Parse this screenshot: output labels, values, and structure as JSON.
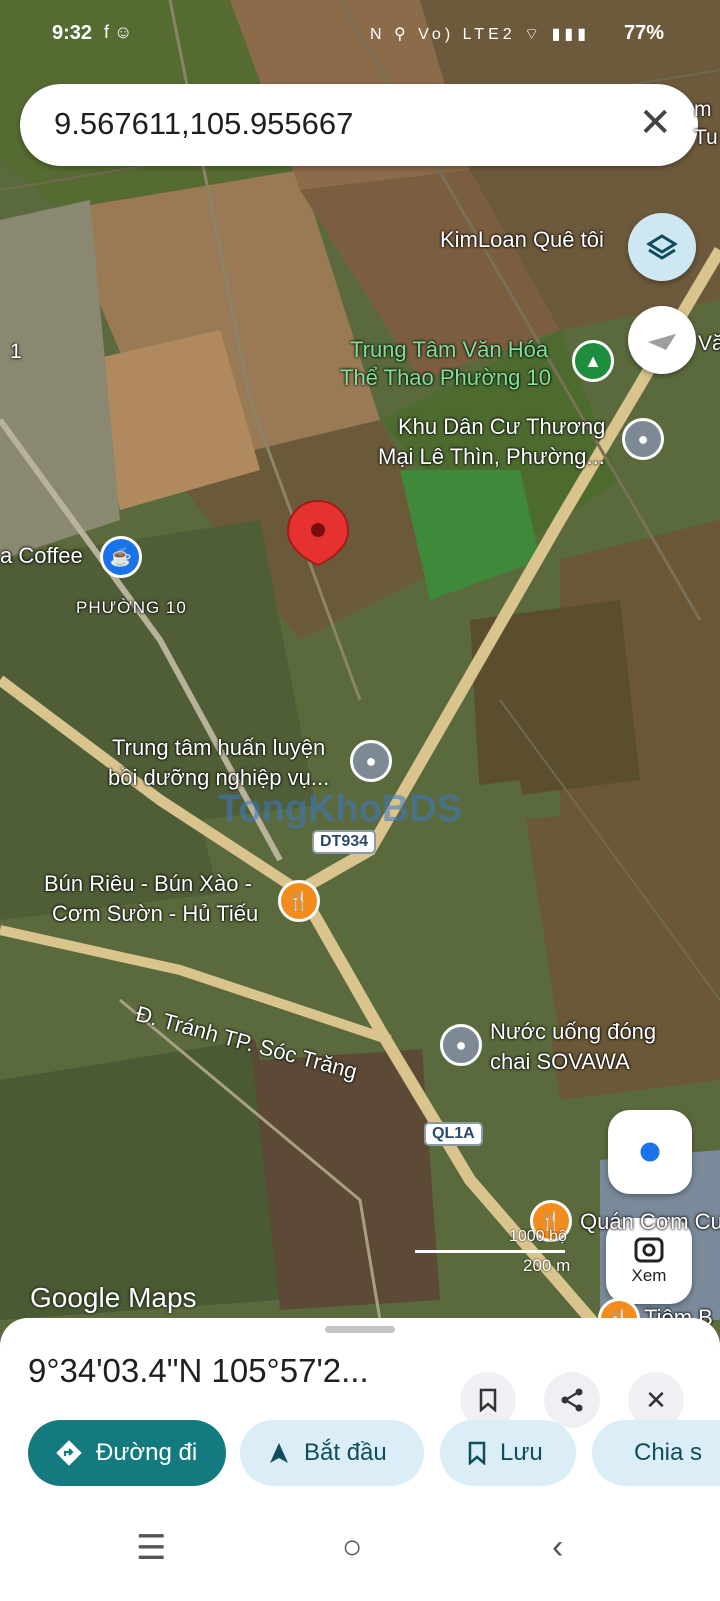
{
  "status_bar": {
    "time": "9:32",
    "battery": "77%",
    "left_icons": "f ☺",
    "right_icons": "N ⚲ Vo) LTE2 ⌔ ▮▮▮"
  },
  "search": {
    "query": "9.567611,105.955667"
  },
  "map": {
    "labels": {
      "kimloan": "KimLoan Quê tôi",
      "trungtam_1": "Trung Tâm Văn Hóa",
      "trungtam_2": "Thể Thao Phường 10",
      "khudancu_1": "Khu Dân Cư Thương",
      "khudancu_2": "Mại Lê Thìn, Phường...",
      "coffee": "a Coffee",
      "phuong10": "PHƯỜNG 10",
      "huanluyen_1": "Trung tâm huấn luyện",
      "huanluyen_2": "bồi dưỡng nghiệp vụ...",
      "bunrieu_1": "Bún Riêu - Bún Xào -",
      "bunrieu_2": "Cơm Sườn - Hủ Tiếu",
      "road_tranh": "Đ. Tránh TP. Sóc Trăng",
      "nuocuong_1": "Nước uống đóng",
      "nuocuong_2": "chai SOVAWA",
      "quan_com": "Quán Cơm Cu",
      "tiem": "Tiệm B",
      "van": "Văn",
      "tu": "Tu",
      "m": "m",
      "one": "1"
    },
    "shields": {
      "dt934": "DT934",
      "ql1a": "QL1A"
    },
    "watermark": "TongKhoBDS",
    "scale": {
      "feet": "1000 bộ",
      "meters": "200 m"
    },
    "google_logo": "Google Maps",
    "lens_label": "Xem"
  },
  "bottom_sheet": {
    "coords": "9°34'03.4\"N 105°57'2...",
    "actions": [
      {
        "label": "Đường đi"
      },
      {
        "label": "Bắt đầu"
      },
      {
        "label": "Lưu"
      },
      {
        "label": "Chia s"
      }
    ]
  },
  "colors": {
    "accent": "#137a80",
    "pin": "#e5312f",
    "chip_bg": "#dbeef7"
  }
}
